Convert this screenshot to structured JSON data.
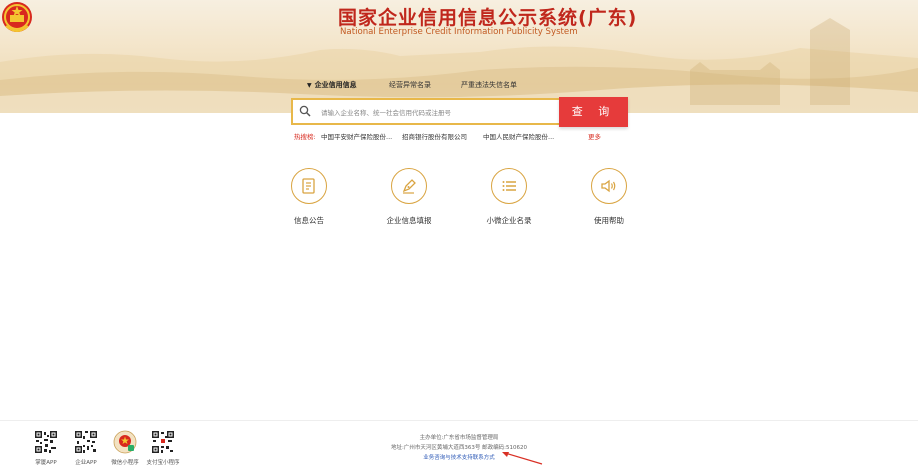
{
  "header": {
    "title": "国家企业信用信息公示系统(广东)",
    "subtitle": "National Enterprise Credit Information Publicity System"
  },
  "tabs": [
    {
      "label": "企业信用信息",
      "active": true
    },
    {
      "label": "经营异常名录",
      "active": false
    },
    {
      "label": "严重违法失信名单",
      "active": false
    }
  ],
  "search": {
    "placeholder": "请输入企业名称、统一社会信用代码或注册号",
    "button_label": "查 询"
  },
  "hot_search": {
    "label": "热搜榜:",
    "items": [
      "中国平安财产保险股份...",
      "招商银行股份有限公司",
      "中国人民财产保险股份..."
    ],
    "more_label": "更多"
  },
  "features": [
    {
      "label": "信息公告",
      "icon": "document-icon"
    },
    {
      "label": "企业信息填报",
      "icon": "pen-icon"
    },
    {
      "label": "小微企业名录",
      "icon": "list-icon"
    },
    {
      "label": "使用帮助",
      "icon": "speaker-icon"
    }
  ],
  "footer": {
    "qr_codes": [
      {
        "label": "掌厦APP"
      },
      {
        "label": "企业APP"
      },
      {
        "label": "微信小程序"
      },
      {
        "label": "支付宝小程序"
      }
    ],
    "sponsor": "主办单位:广东省市场监督管理局",
    "address": "地址:广州市天河区黄埔大道西363号  邮政编码:510620",
    "contact_link": "业务咨询与技术支持联系方式"
  },
  "colors": {
    "brand_red": "#c0271c",
    "search_button": "#e63b3b",
    "accent_gold": "#d9a441",
    "link_blue": "#2f5bb7"
  }
}
